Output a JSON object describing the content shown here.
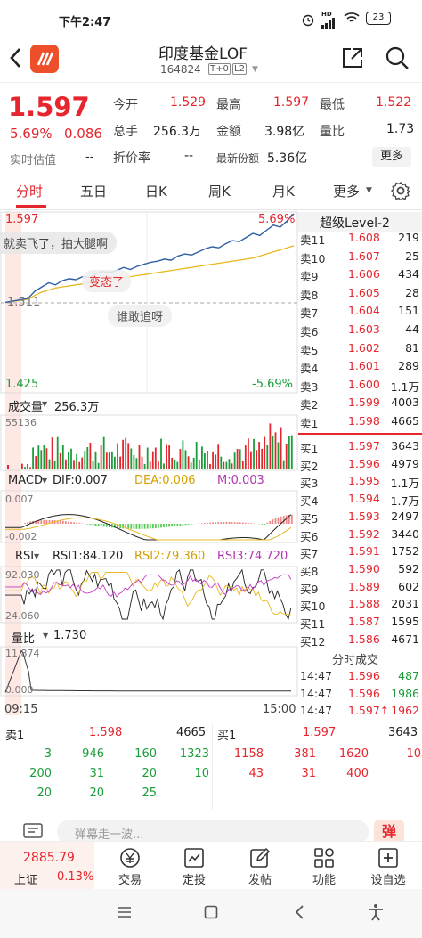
{
  "status": {
    "time": "下午2:47",
    "battery": "23",
    "hd": "HD"
  },
  "header": {
    "title": "印度基金LOF",
    "code": "164824",
    "tag1": "T+0",
    "tag2": "L2"
  },
  "quote": {
    "price": "1.597",
    "pct": "5.69%",
    "chg": "0.086",
    "est_label": "实时估值",
    "est_value": "--",
    "open_label": "今开",
    "open": "1.529",
    "high_label": "最高",
    "high": "1.597",
    "low_label": "最低",
    "low": "1.522",
    "vol_label": "总手",
    "vol": "256.3万",
    "amt_label": "金额",
    "amt": "3.98亿",
    "ratio_label": "量比",
    "ratio": "1.73",
    "disc_label": "折价率",
    "disc": "--",
    "shares_label": "最新份额",
    "shares": "5.36亿",
    "more": "更多"
  },
  "tabs": [
    "分时",
    "五日",
    "日K",
    "周K",
    "月K",
    "更多"
  ],
  "chart": {
    "ytop": "1.597",
    "ypct_top": "5.69%",
    "ymid": "1.511",
    "ybot": "1.425",
    "ypct_bot": "-5.69%",
    "danmu1": "就卖飞了，拍大腿啊",
    "danmu2": "变态了",
    "danmu3": "谁敢追呀",
    "vol_label": "成交量",
    "vol_value": "256.3万",
    "vol_max": "55136",
    "macd_label": "MACD",
    "dif": "DIF:0.007",
    "dea": "DEA:0.006",
    "m": "M:0.003",
    "macd_top": "0.007",
    "macd_bot": "-0.002",
    "rsi_label": "RSI",
    "rsi1": "RSI1:84.120",
    "rsi2": "RSI2:79.360",
    "rsi3": "RSI3:74.720",
    "rsi_top": "92.030",
    "rsi_bot": "24.060",
    "lb_label": "量比",
    "lb_value": "1.730",
    "lb_top": "11.874",
    "lb_bot": "0.000",
    "t_start": "09:15",
    "t_end": "15:00",
    "price_line": [
      1.511,
      1.515,
      1.522,
      1.526,
      1.53,
      1.528,
      1.532,
      1.534,
      1.533,
      1.536,
      1.535,
      1.539,
      1.541,
      1.54,
      1.542,
      1.545,
      1.543,
      1.546,
      1.548,
      1.55,
      1.551,
      1.553,
      1.552,
      1.556,
      1.558,
      1.557,
      1.56,
      1.563,
      1.565,
      1.564,
      1.568,
      1.571,
      1.57,
      1.574,
      1.578,
      1.576,
      1.581,
      1.586,
      1.584,
      1.59,
      1.597
    ],
    "avg_line": [
      1.511,
      1.514,
      1.518,
      1.521,
      1.523,
      1.525,
      1.526,
      1.527,
      1.528,
      1.529,
      1.53,
      1.531,
      1.532,
      1.533,
      1.534,
      1.535,
      1.536,
      1.537,
      1.538,
      1.539,
      1.54,
      1.541,
      1.542,
      1.543,
      1.544,
      1.545,
      1.546,
      1.547,
      1.548,
      1.549,
      1.55,
      1.551,
      1.552,
      1.553,
      1.554,
      1.556,
      1.558,
      1.56,
      1.562,
      1.564,
      1.566
    ]
  },
  "book": {
    "title": "超级Level-2",
    "asks": [
      [
        "卖11",
        "1.608",
        "219"
      ],
      [
        "卖10",
        "1.607",
        "25"
      ],
      [
        "卖9",
        "1.606",
        "434"
      ],
      [
        "卖8",
        "1.605",
        "28"
      ],
      [
        "卖7",
        "1.604",
        "151"
      ],
      [
        "卖6",
        "1.603",
        "44"
      ],
      [
        "卖5",
        "1.602",
        "81"
      ],
      [
        "卖4",
        "1.601",
        "289"
      ],
      [
        "卖3",
        "1.600",
        "1.1万"
      ],
      [
        "卖2",
        "1.599",
        "4003"
      ],
      [
        "卖1",
        "1.598",
        "4665"
      ]
    ],
    "bids": [
      [
        "买1",
        "1.597",
        "3643"
      ],
      [
        "买2",
        "1.596",
        "4979"
      ],
      [
        "买3",
        "1.595",
        "1.1万"
      ],
      [
        "买4",
        "1.594",
        "1.7万"
      ],
      [
        "买5",
        "1.593",
        "2497"
      ],
      [
        "买6",
        "1.592",
        "3440"
      ],
      [
        "买7",
        "1.591",
        "1752"
      ],
      [
        "买8",
        "1.590",
        "592"
      ],
      [
        "买9",
        "1.589",
        "602"
      ],
      [
        "买10",
        "1.588",
        "2031"
      ],
      [
        "买11",
        "1.587",
        "1595"
      ],
      [
        "买12",
        "1.586",
        "4671"
      ]
    ],
    "trade_title": "分时成交",
    "trades": [
      [
        "14:47",
        "1.596",
        "487"
      ],
      [
        "14:47",
        "1.596",
        "1986"
      ],
      [
        "14:47",
        "1.597↑",
        "1962"
      ]
    ]
  },
  "queue": {
    "sell_label": "卖1",
    "sell_price": "1.598",
    "sell_vol": "4665",
    "buy_label": "买1",
    "buy_price": "1.597",
    "buy_vol": "3643",
    "sell_rows": [
      [
        "3",
        "946",
        "160",
        "1323"
      ],
      [
        "200",
        "31",
        "20",
        "10"
      ],
      [
        "20",
        "20",
        "25",
        ""
      ]
    ],
    "buy_rows": [
      [
        "1158",
        "381",
        "1620",
        "10"
      ],
      [
        "43",
        "31",
        "400",
        ""
      ]
    ]
  },
  "danmu": {
    "placeholder": "弹幕走一波...",
    "btn": "弹"
  },
  "nav": {
    "index_value": "2885.79",
    "index_name": "上证",
    "index_pct": "0.13%",
    "items": [
      "交易",
      "定投",
      "发帖",
      "功能",
      "设自选"
    ]
  }
}
